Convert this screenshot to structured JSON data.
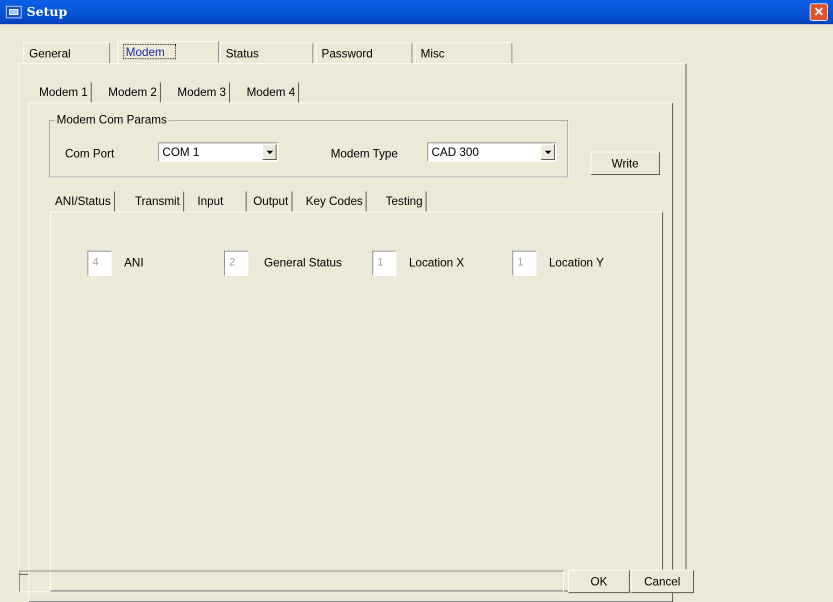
{
  "window": {
    "title": "Setup"
  },
  "main_tabs": [
    {
      "label": "General"
    },
    {
      "label": "Modem"
    },
    {
      "label": "Status"
    },
    {
      "label": "Password"
    },
    {
      "label": "Misc"
    }
  ],
  "modem_tabs": [
    {
      "label": "Modem 1"
    },
    {
      "label": "Modem 2"
    },
    {
      "label": "Modem 3"
    },
    {
      "label": "Modem 4"
    }
  ],
  "com_params": {
    "legend": "Modem Com Params",
    "com_port_label": "Com Port",
    "com_port_value": "COM 1",
    "modem_type_label": "Modem Type",
    "modem_type_value": "CAD 300"
  },
  "write_label": "Write",
  "detail_tabs": [
    {
      "label": "ANI/Status"
    },
    {
      "label": "Transmit"
    },
    {
      "label": "Input"
    },
    {
      "label": "Output"
    },
    {
      "label": "Key Codes"
    },
    {
      "label": "Testing"
    }
  ],
  "fields": [
    {
      "value": "4",
      "label": "ANI"
    },
    {
      "value": "2",
      "label": "General Status"
    },
    {
      "value": "1",
      "label": "Location X"
    },
    {
      "value": "1",
      "label": "Location Y"
    }
  ],
  "footer": {
    "status_text": "",
    "ok_label": "OK",
    "cancel_label": "Cancel"
  }
}
